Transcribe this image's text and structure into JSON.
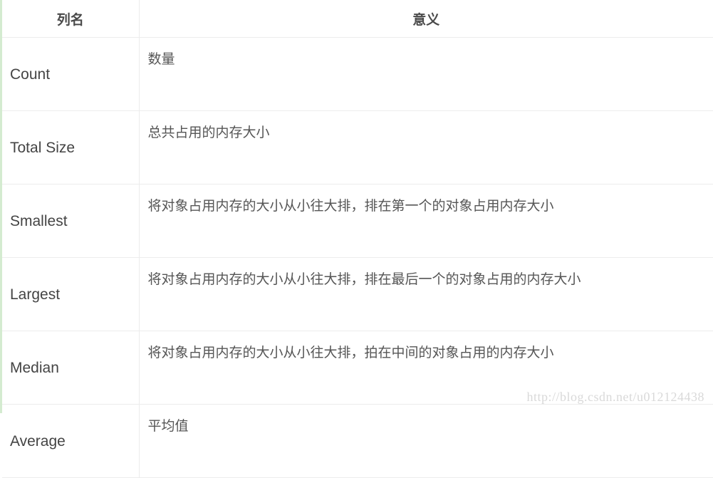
{
  "table": {
    "headers": [
      "列名",
      "意义"
    ],
    "rows": [
      {
        "name": "Count",
        "meaning": "数量"
      },
      {
        "name": "Total Size",
        "meaning": "总共占用的内存大小"
      },
      {
        "name": "Smallest",
        "meaning": "将对象占用内存的大小从小往大排，排在第一个的对象占用内存大小"
      },
      {
        "name": "Largest",
        "meaning": "将对象占用内存的大小从小往大排，排在最后一个的对象占用的内存大小"
      },
      {
        "name": "Median",
        "meaning": "将对象占用内存的大小从小往大排，拍在中间的对象占用的内存大小"
      },
      {
        "name": "Average",
        "meaning": "平均值"
      }
    ]
  },
  "watermark": "http://blog.csdn.net/u012124438",
  "colors": {
    "left_stripe": "#d4ebd0",
    "border": "#ececec",
    "text": "#444444",
    "watermark": "#d9d9d9"
  }
}
